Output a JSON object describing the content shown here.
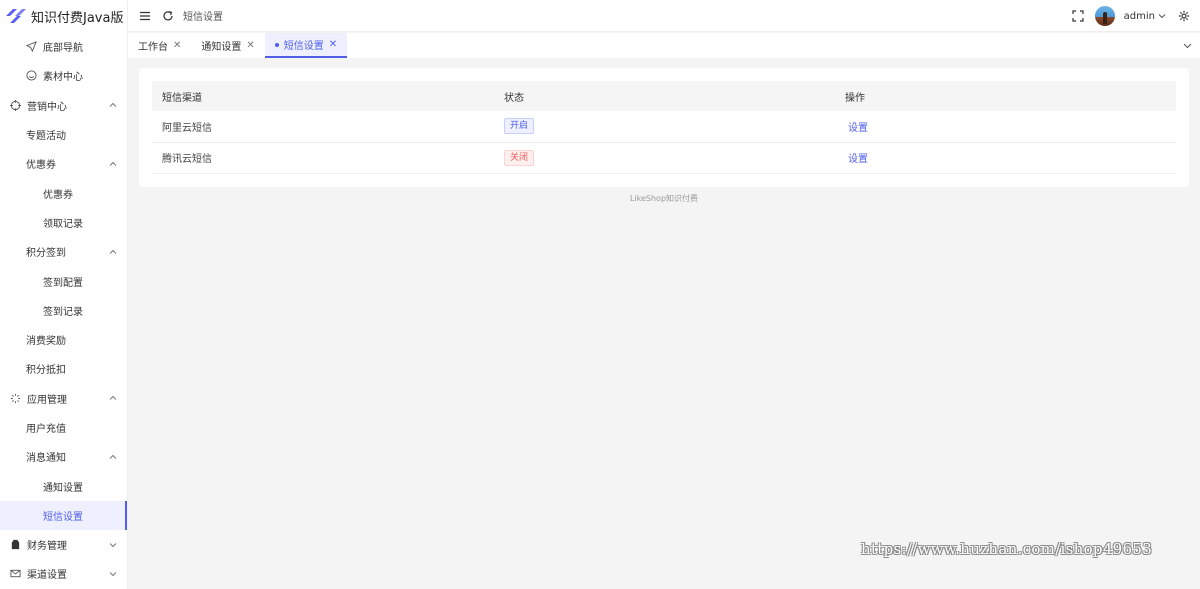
{
  "app": {
    "title": "知识付费Java版"
  },
  "sidebar": {
    "items": [
      {
        "label": "底部导航",
        "level": 2,
        "icon": "send-icon"
      },
      {
        "label": "素材中心",
        "level": 2,
        "icon": "smile-icon"
      },
      {
        "label": "营销中心",
        "level": 1,
        "icon": "target-icon",
        "expanded": true
      },
      {
        "label": "专题活动",
        "level": 2
      },
      {
        "label": "优惠券",
        "level": 2,
        "expanded": true
      },
      {
        "label": "优惠券",
        "level": 3
      },
      {
        "label": "领取记录",
        "level": 3
      },
      {
        "label": "积分签到",
        "level": 2,
        "expanded": true
      },
      {
        "label": "签到配置",
        "level": 3
      },
      {
        "label": "签到记录",
        "level": 3
      },
      {
        "label": "消费奖励",
        "level": 2
      },
      {
        "label": "积分抵扣",
        "level": 2
      },
      {
        "label": "应用管理",
        "level": 1,
        "icon": "loading-icon",
        "expanded": true
      },
      {
        "label": "用户充值",
        "level": 2
      },
      {
        "label": "消息通知",
        "level": 2,
        "expanded": true
      },
      {
        "label": "通知设置",
        "level": 3
      },
      {
        "label": "短信设置",
        "level": 3,
        "active": true
      },
      {
        "label": "财务管理",
        "level": 1,
        "icon": "wallet-icon",
        "expanded": false
      },
      {
        "label": "渠道设置",
        "level": 1,
        "icon": "mail-icon",
        "expanded": false
      }
    ]
  },
  "header": {
    "breadcrumb": "短信设置",
    "user": "admin"
  },
  "tabs": [
    {
      "label": "工作台",
      "active": false
    },
    {
      "label": "通知设置",
      "active": false
    },
    {
      "label": "短信设置",
      "active": true
    }
  ],
  "table": {
    "columns": [
      "短信渠道",
      "状态",
      "操作"
    ],
    "rows": [
      {
        "channel": "阿里云短信",
        "status": "开启",
        "status_type": "on",
        "action": "设置"
      },
      {
        "channel": "腾讯云短信",
        "status": "关闭",
        "status_type": "off",
        "action": "设置"
      }
    ]
  },
  "footer": "LikeShop知识付费",
  "watermark": "https://www.huzhan.com/ishop49653",
  "colors": {
    "accent": "#4f5fe8",
    "danger": "#f05a5a"
  }
}
